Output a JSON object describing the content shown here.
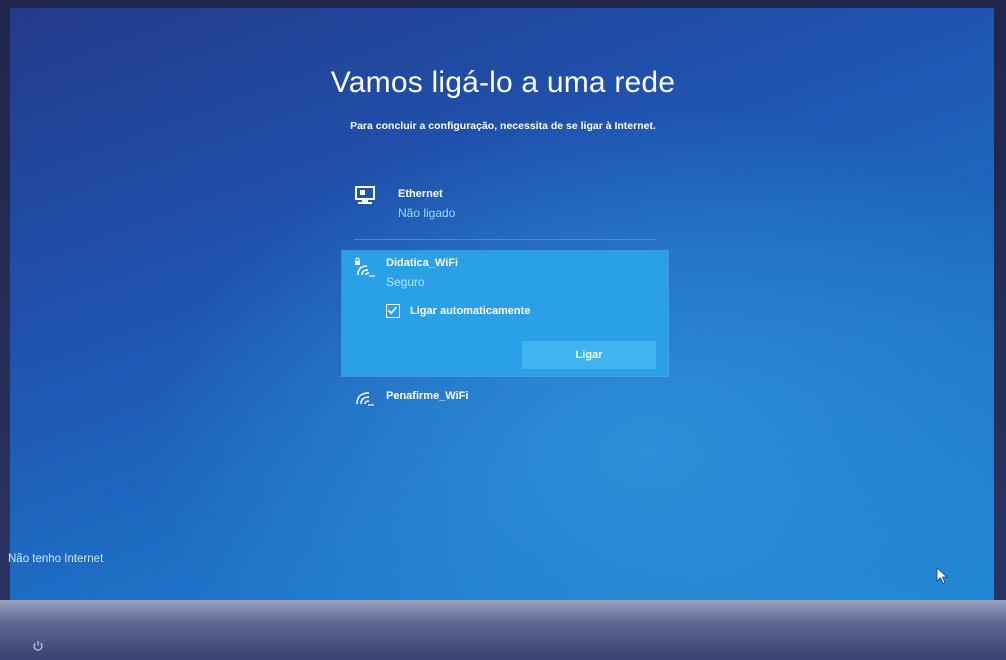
{
  "page": {
    "title": "Vamos ligá-lo a uma rede",
    "subtitle": "Para concluir a configuração, necessita de se ligar à Internet."
  },
  "networks": {
    "ethernet": {
      "name": "Ethernet",
      "status": "Não ligado",
      "icon": "ethernet-monitor-icon"
    },
    "wifi_selected": {
      "name": "Didatica_WiFi",
      "status": "Seguro",
      "icon": "wifi-secured-icon",
      "auto_connect_label": "Ligar automaticamente",
      "auto_connect_checked": true,
      "connect_label": "Ligar"
    },
    "wifi_other": {
      "name": "Penafirme_WiFi",
      "icon": "wifi-icon"
    }
  },
  "footer": {
    "no_internet_label": "Não tenho Internet"
  },
  "colors": {
    "accent": "#2aa0e6",
    "button": "#41b3ee",
    "status_text": "#9fd6ff"
  }
}
